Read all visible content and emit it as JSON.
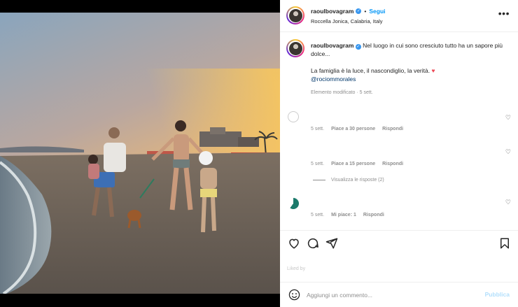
{
  "header": {
    "username": "raoulbovagram",
    "verified_icon": "verified-badge-icon",
    "separator": "•",
    "follow_label": "Segui",
    "location": "Roccella Jonica, Calabria, Italy",
    "more_icon": "more-options-icon"
  },
  "caption": {
    "username": "raoulbovagram",
    "text_line1": "Nel luogo in cui sono cresciuto tutto ha un sapore più dolce...",
    "text_line2": "La famiglia è la luce, il nascondiglio, la verità.",
    "mention": "@rociommorales",
    "meta": "Elemento modificato · 5 sett."
  },
  "comments": [
    {
      "time": "5 sett.",
      "likes": "Piace a 30 persone",
      "reply": "Rispondi"
    },
    {
      "time": "5 sett.",
      "likes": "Piace a 15 persone",
      "reply": "Rispondi",
      "view_replies": "Visualizza le risposte (2)"
    },
    {
      "time": "5 sett.",
      "likes": "Mi piace: 1",
      "reply": "Rispondi"
    }
  ],
  "likes_text": "Liked by",
  "add_comment": {
    "placeholder": "Aggiungi un commento...",
    "publish_label": "Pubblica"
  },
  "colors": {
    "accent": "#0095f6",
    "heart": "#ed4956",
    "publish_disabled": "#b2dffc"
  }
}
